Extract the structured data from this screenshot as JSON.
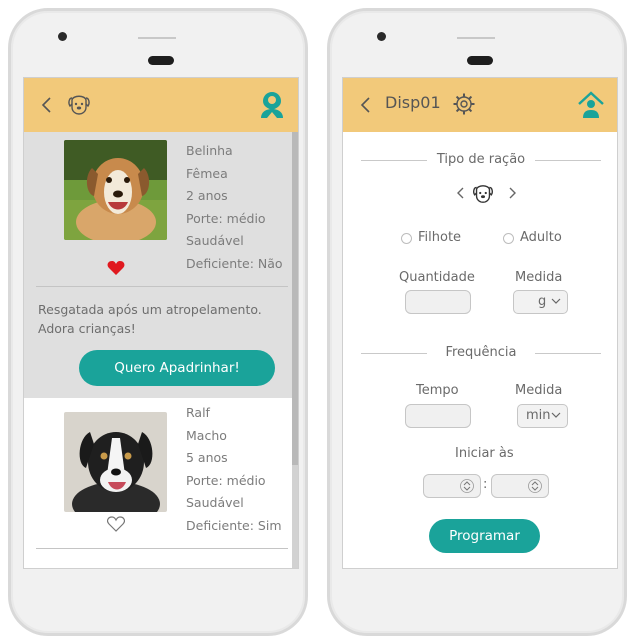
{
  "left_screen": {
    "pets": [
      {
        "name": "Belinha",
        "sex": "Fêmea",
        "age": "2 anos",
        "size": "Porte: médio",
        "health": "Saudável",
        "disabled": "Deficiente: Não",
        "favorited": true,
        "description": "Resgatada após um atropelamento. Adora crianças!",
        "cta_label": "Quero Apadrinhar!"
      },
      {
        "name": "Ralf",
        "sex": "Macho",
        "age": "5 anos",
        "size": "Porte: médio",
        "health": "Saudável",
        "disabled": "Deficiente: Sim",
        "favorited": false
      }
    ]
  },
  "right_screen": {
    "device_title": "Disp01",
    "section_food": "Tipo de ração",
    "radio_options": [
      "Filhote",
      "Adulto"
    ],
    "quantity_label": "Quantidade",
    "measure_label": "Medida",
    "measure_value_g": "g",
    "section_frequency": "Frequência",
    "time_label": "Tempo",
    "measure_value_min": "min",
    "start_label": "Iniciar às",
    "time_separator": ":",
    "program_label": "Programar"
  },
  "colors": {
    "appbar": "#f2c97a",
    "accent": "#1aa39a",
    "heart": "#e0191f"
  },
  "icons": [
    "back-chevron-icon",
    "dog-face-icon",
    "home-person-icon",
    "gear-icon",
    "heart-icon",
    "chevron-down-icon",
    "spinner-arrows-icon"
  ]
}
